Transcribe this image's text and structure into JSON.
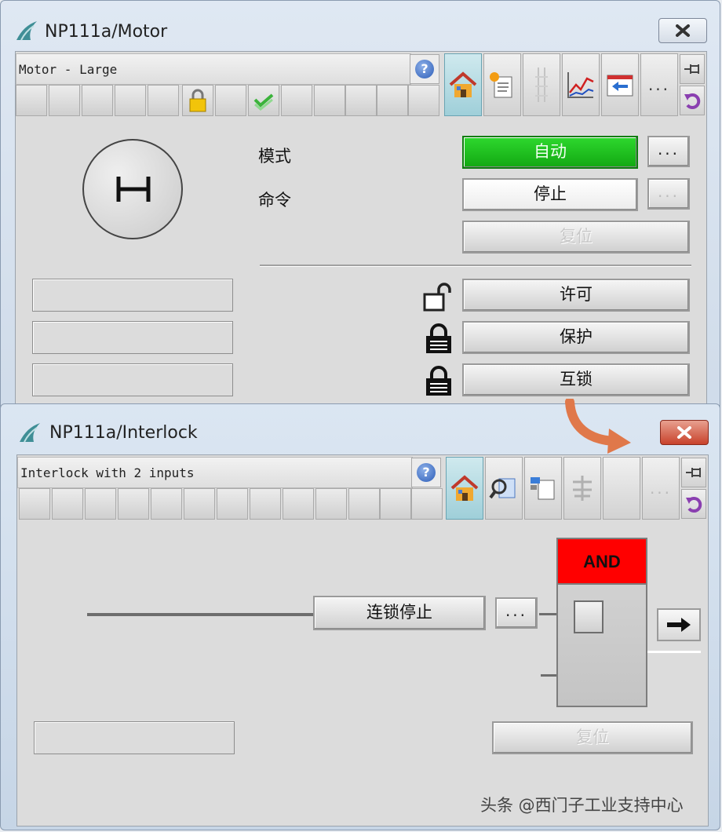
{
  "motor_window": {
    "title": "NP111a/Motor",
    "tagline": "Motor - Large",
    "mode_label": "模式",
    "command_label": "命令",
    "mode_value": "自动",
    "command_value": "停止",
    "reset_label": "复位",
    "permit_label": "许可",
    "protect_label": "保护",
    "interlock_label": "互锁",
    "dots_label": "...",
    "icons": [
      "help-icon",
      "lock-icon",
      "check-icon",
      "home-icon",
      "batch-icon",
      "bar-icon",
      "trend-icon",
      "message-icon",
      "more-icon",
      "pin-icon",
      "undo-icon",
      "motor-symbol",
      "unlock-icon"
    ],
    "colors": {
      "auto": "#1ec21e"
    }
  },
  "interlock_window": {
    "title": "NP111a/Interlock",
    "tagline": "Interlock with 2 inputs",
    "interlock_stop_label": "连锁停止",
    "and_label": "AND",
    "reset_label": "复位",
    "dots_label": "...",
    "icons": [
      "home-icon",
      "zoom-icon",
      "graph-icon",
      "chain-icon",
      "arrow-right-icon"
    ],
    "colors": {
      "and_block": "#ff0000",
      "close": "#c8422b",
      "annotation_arrow": "#e0784a"
    }
  },
  "watermark": "头条 @西门子工业支持中心"
}
